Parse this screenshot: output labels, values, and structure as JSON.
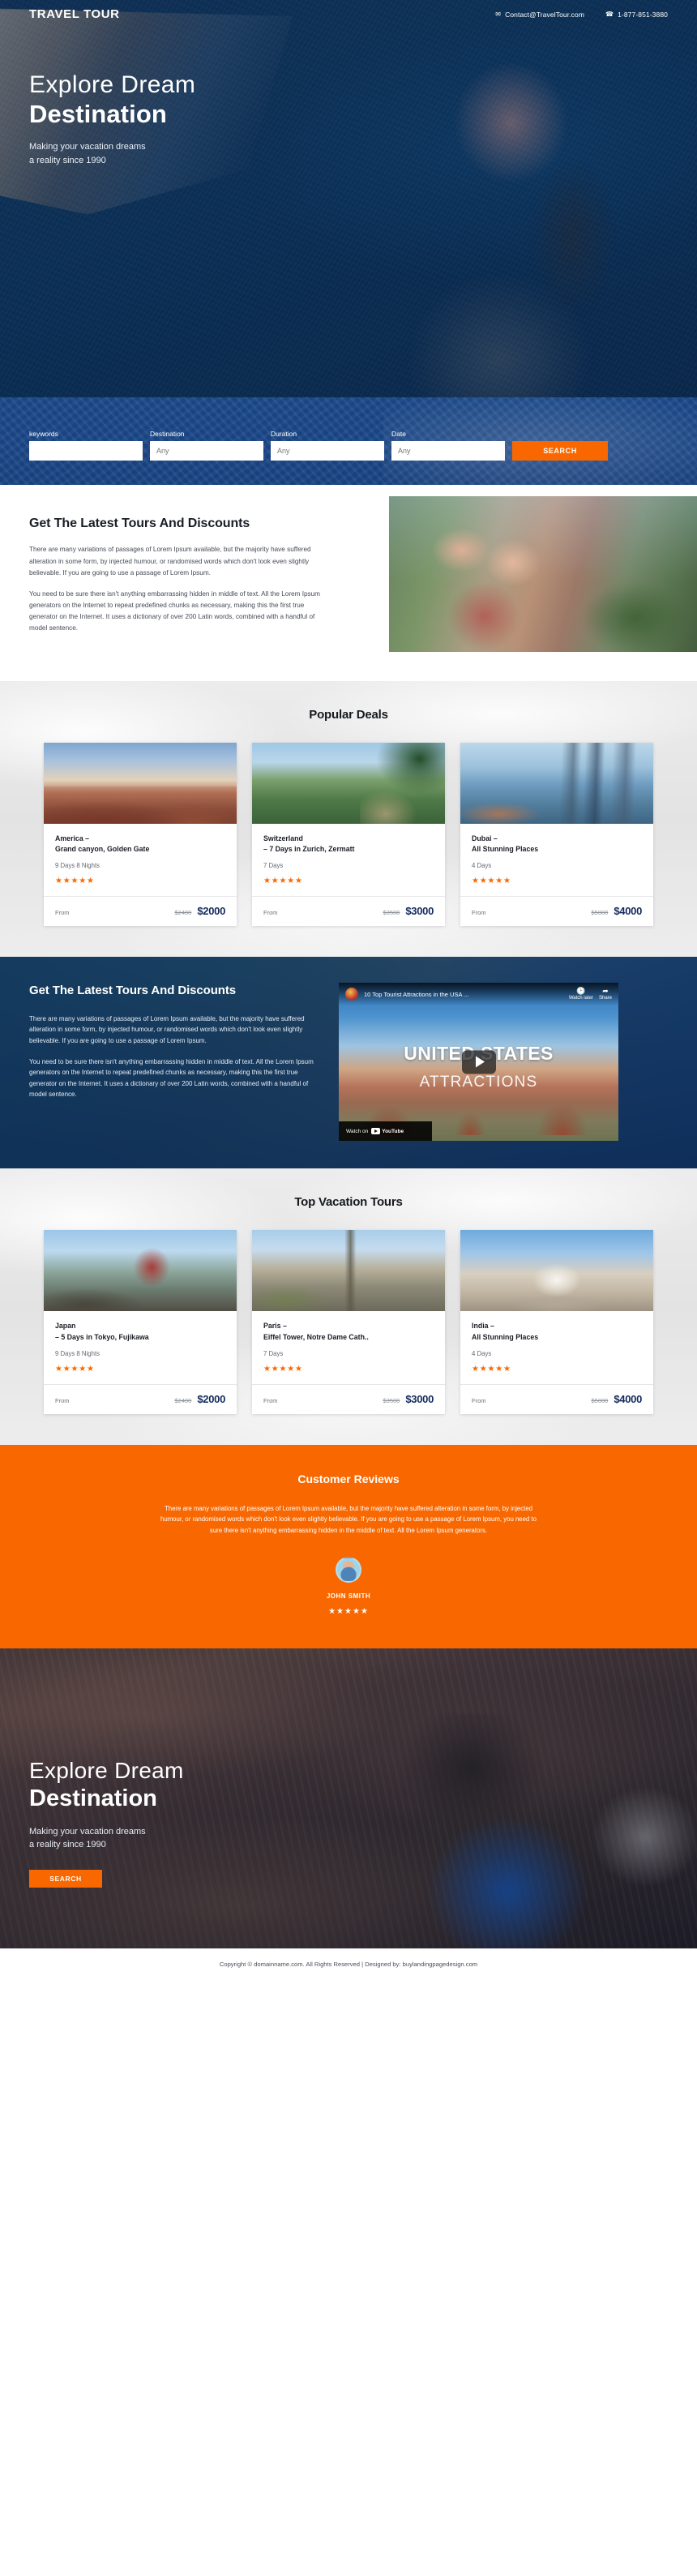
{
  "header": {
    "brand": "TRAVEL TOUR",
    "email_icon": "envelope-icon",
    "email": "Contact@TravelTour.com",
    "phone_icon": "phone-icon",
    "phone": "1-877-851-3880"
  },
  "hero": {
    "title_light": "Explore Dream",
    "title_bold": "Destination",
    "subtitle_line1": "Making your vacation dreams",
    "subtitle_line2": "a reality since 1990"
  },
  "search": {
    "fields": [
      {
        "label": "keywords",
        "value": "",
        "placeholder": ""
      },
      {
        "label": "Destination",
        "value": "",
        "placeholder": "Any"
      },
      {
        "label": "Duration",
        "value": "",
        "placeholder": "Any"
      },
      {
        "label": "Date",
        "value": "",
        "placeholder": "Any"
      }
    ],
    "button_label": "SEARCH"
  },
  "latest_white": {
    "heading": "Get The Latest Tours And Discounts",
    "paragraph1": "There are many variations of passages of Lorem Ipsum available, but the majority have suffered alteration in some form, by injected humour, or randomised words which don't look even slightly believable. If you are going to use a passage of Lorem Ipsum.",
    "paragraph2": "You need to be sure there isn't anything embarrassing hidden in middle of text. All the Lorem Ipsum generators on the Internet to repeat predefined chunks as necessary, making this the first true generator on the Internet. It uses a dictionary of over 200 Latin words, combined with a handful of model sentence."
  },
  "popular_deals": {
    "title": "Popular Deals",
    "from_label": "From",
    "cards": [
      {
        "image": "grand-canyon-photo",
        "title_line1": "America –",
        "title_line2": "Grand canyon, Golden Gate",
        "duration": "9 Days 8 Nights",
        "rating": 5,
        "stars": "★★★★★",
        "price_old": "$2400",
        "price_new": "$2000"
      },
      {
        "image": "switzerland-photo",
        "title_line1": "Switzerland",
        "title_line2": "– 7 Days in Zurich, Zermatt",
        "duration": "7 Days",
        "rating": 5,
        "stars": "★★★★★",
        "price_old": "$3500",
        "price_new": "$3000"
      },
      {
        "image": "dubai-photo",
        "title_line1": "Dubai –",
        "title_line2": "All Stunning Places",
        "duration": "4 Days",
        "rating": 5,
        "stars": "★★★★★",
        "price_old": "$5000",
        "price_new": "$4000"
      }
    ]
  },
  "video_section": {
    "heading": "Get The Latest Tours And Discounts",
    "paragraph1": "There are many variations of passages of Lorem Ipsum available, but the majority have suffered alteration in some form, by injected humour, or randomised words which don't look even slightly believable. If you are going to use a passage of Lorem Ipsum.",
    "paragraph2": "You need to be sure there isn't anything embarrassing hidden in middle of text. All the Lorem Ipsum generators on the Internet to repeat predefined chunks as necessary, making this the first true generator on the Internet. It uses a dictionary of over 200 Latin words, combined with a handful of model sentence.",
    "player": {
      "video_title": "10 Top Tourist Attractions in the USA ...",
      "watch_later_icon": "clock-icon",
      "watch_later_label": "Watch later",
      "share_icon": "share-arrow-icon",
      "share_label": "Share",
      "overlay_line1": "UNITED STATES",
      "overlay_line2": "ATTRACTIONS",
      "play_icon": "play-button-icon",
      "watch_on_label": "Watch on",
      "platform": "YouTube"
    }
  },
  "top_tours": {
    "title": "Top Vacation Tours",
    "from_label": "From",
    "cards": [
      {
        "image": "japan-pagoda-photo",
        "title_line1": "Japan",
        "title_line2": "– 5 Days in Tokyo, Fujikawa",
        "duration": "9 Days 8 Nights",
        "rating": 5,
        "stars": "★★★★★",
        "price_old": "$2400",
        "price_new": "$2000"
      },
      {
        "image": "paris-eiffel-photo",
        "title_line1": "Paris –",
        "title_line2": "Eiffel Tower, Notre Dame Cath..",
        "duration": "7 Days",
        "rating": 5,
        "stars": "★★★★★",
        "price_old": "$3500",
        "price_new": "$3000"
      },
      {
        "image": "india-taj-mahal-photo",
        "title_line1": "India –",
        "title_line2": "All Stunning Places",
        "duration": "4 Days",
        "rating": 5,
        "stars": "★★★★★",
        "price_old": "$5000",
        "price_new": "$4000"
      }
    ]
  },
  "reviews": {
    "title": "Customer Reviews",
    "body": "There are many variations of passages of Lorem Ipsum available, but the majority have suffered alteration in some form, by injected humour, or randomised words which don't look even slightly believable. If you are going to use a passage of Lorem Ipsum, you need to sure there isn't anything embarrassing hidden in the middle of text. All the Lorem Ipsum generators.",
    "avatar": "reviewer-avatar",
    "name": "JOHN SMITH",
    "rating": 5,
    "stars": "★★★★★"
  },
  "cta": {
    "title_light": "Explore Dream",
    "title_bold": "Destination",
    "subtitle_line1": "Making your vacation dreams",
    "subtitle_line2": "a reality since 1990",
    "button_label": "SEARCH"
  },
  "footer": {
    "text": "Copyright © domainname.com. All Rights Reserved | Designed by: buylandingpagedesign.com"
  },
  "colors": {
    "accent_orange": "#f96800",
    "brand_blue": "#123a72",
    "search_band_blue": "#1b4a8c",
    "price_navy": "#132a5e"
  }
}
